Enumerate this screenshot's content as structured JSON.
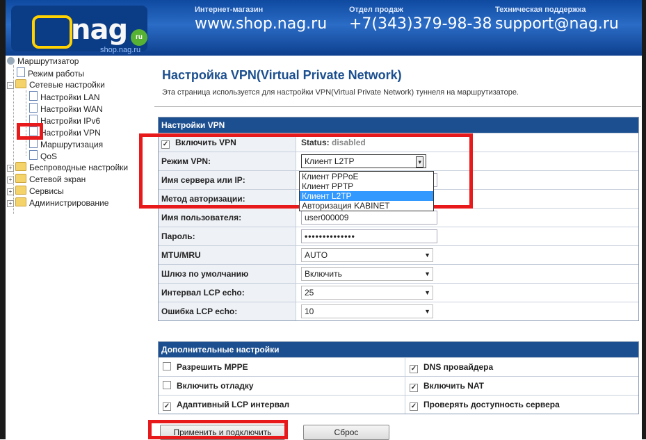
{
  "header": {
    "logo_text": "nag",
    "logo_badge": "ru",
    "logo_sub": "shop.nag.ru",
    "shop_caption": "Интернет-магазин",
    "shop_value": "www.shop.nag.ru",
    "sales_caption": "Отдел продаж",
    "sales_value": "+7(343)379-98-38",
    "support_caption": "Техническая поддержка",
    "support_value": "support@nag.ru"
  },
  "tree": {
    "root": "Маршрутизатор",
    "items": [
      {
        "label": "Режим работы"
      },
      {
        "label": "Сетевые настройки"
      },
      {
        "label": "Настройки LAN"
      },
      {
        "label": "Настройки WAN"
      },
      {
        "label": "Настройки IPv6"
      },
      {
        "label": "Настройки VPN"
      },
      {
        "label": "Маршрутизация"
      },
      {
        "label": "QoS"
      },
      {
        "label": "Беспроводные настройки"
      },
      {
        "label": "Сетевой экран"
      },
      {
        "label": "Сервисы"
      },
      {
        "label": "Администрирование"
      }
    ]
  },
  "page": {
    "title": "Настройка VPN(Virtual Private Network)",
    "description": "Эта страница используется для настройки VPN(Virtual Private Network) туннеля на маршрутизаторе."
  },
  "vpn_section": {
    "heading": "Настройки VPN",
    "enable_label": "Включить VPN",
    "status_label": "Status:",
    "status_value": "disabled",
    "mode_label": "Режим VPN:",
    "mode_value": "Клиент L2TP",
    "server_label": "Имя сервера или IP:",
    "auth_label": "Метод авторизации:",
    "user_label": "Имя пользователя:",
    "user_value": "user000009",
    "password_label": "Пароль:",
    "password_value": "••••••••••••••",
    "mtu_label": "MTU/MRU",
    "mtu_value": "AUTO",
    "gateway_label": "Шлюз по умолчанию",
    "gateway_value": "Включить",
    "lcp_interval_label": "Интервал LCP echo:",
    "lcp_interval_value": "25",
    "lcp_error_label": "Ошибка LCP echo:",
    "lcp_error_value": "10"
  },
  "mode_dropdown": {
    "options": [
      "Клиент PPPoE",
      "Клиент PPTP",
      "Клиент L2TP",
      "Авторизация KABINET"
    ],
    "selected_index": 2
  },
  "advanced": {
    "heading": "Дополнительные настройки",
    "mppe": "Разрешить MPPE",
    "dns": "DNS провайдера",
    "debug": "Включить отладку",
    "nat": "Включить NAT",
    "adaptive_lcp": "Адаптивный LCP интервал",
    "check_server": "Проверять доступность сервера"
  },
  "buttons": {
    "apply": "Применить и подключить",
    "reset": "Сброс"
  },
  "colors": {
    "section_header": "#1c4f8f",
    "highlight": "#e8191b",
    "dropdown_selected": "#3399ff"
  }
}
